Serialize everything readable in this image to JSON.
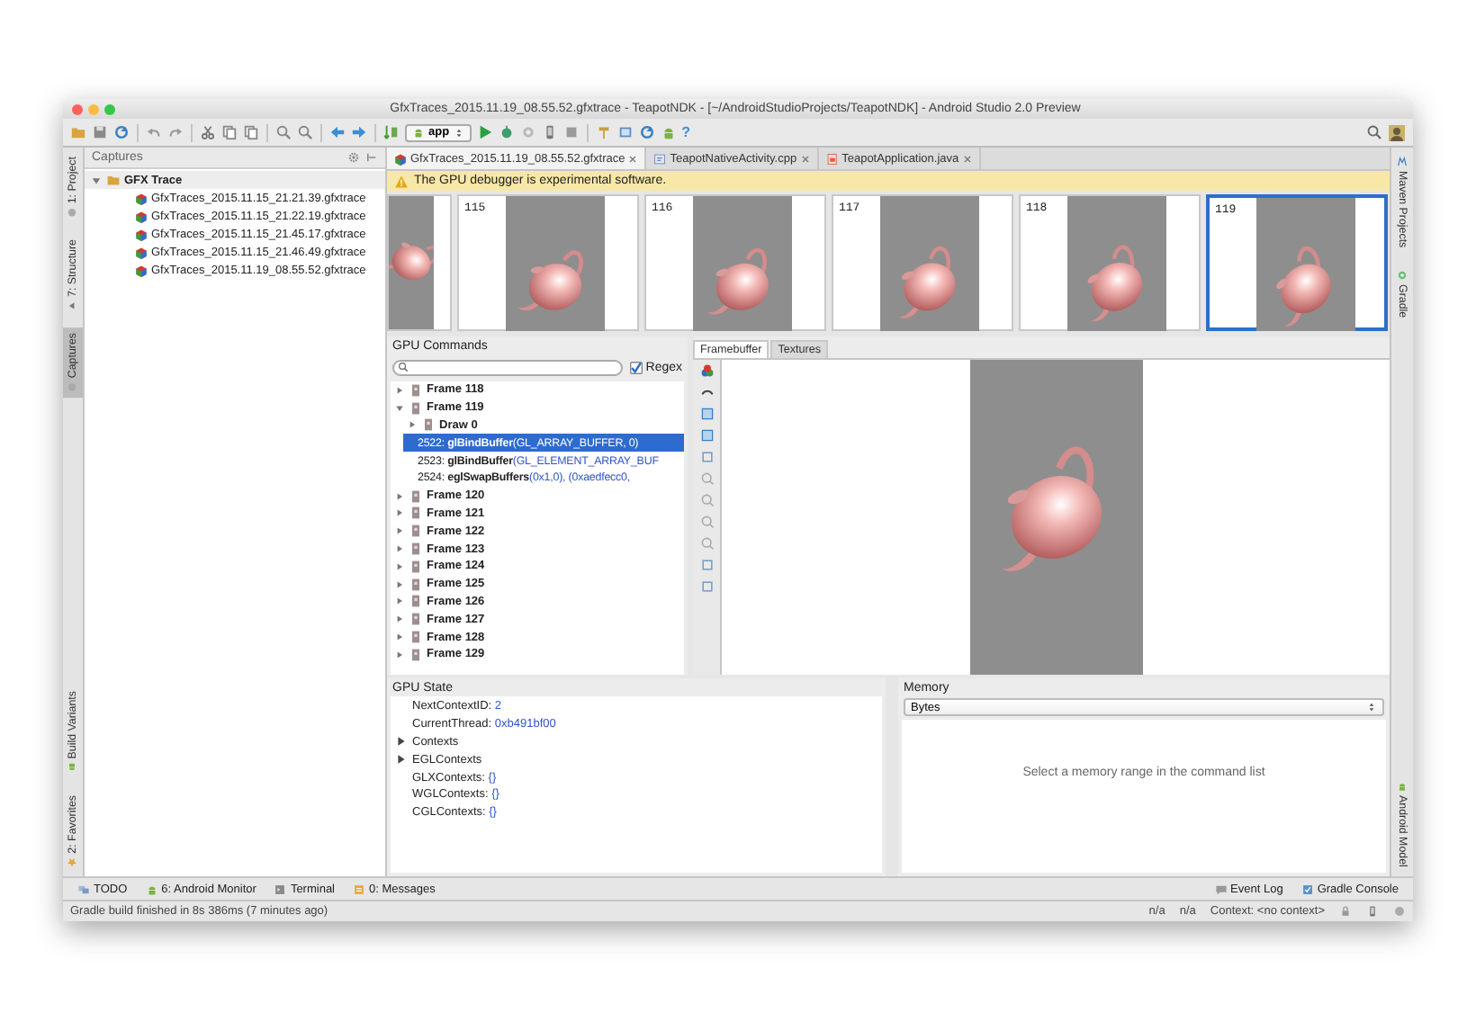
{
  "window": {
    "title": "GfxTraces_2015.11.19_08.55.52.gfxtrace - TeapotNDK - [~/AndroidStudioProjects/TeapotNDK] - Android Studio 2.0 Preview"
  },
  "toolbar": {
    "run_config": "app",
    "help": "?"
  },
  "left_tool_strip": {
    "top": [
      {
        "label": "1: Project",
        "selected": false
      },
      {
        "label": "7: Structure",
        "selected": false
      },
      {
        "label": "Captures",
        "selected": true
      }
    ],
    "bottom": [
      {
        "label": "Build Variants",
        "selected": false
      },
      {
        "label": "2: Favorites",
        "selected": false
      }
    ]
  },
  "captures": {
    "title": "Captures",
    "tree": [
      {
        "label": "GFX Trace",
        "expanded": true,
        "children": [
          {
            "label": "GfxTraces_2015.11.15_21.21.39.gfxtrace"
          },
          {
            "label": "GfxTraces_2015.11.15_21.22.19.gfxtrace"
          },
          {
            "label": "GfxTraces_2015.11.15_21.45.17.gfxtrace"
          },
          {
            "label": "GfxTraces_2015.11.15_21.46.49.gfxtrace"
          },
          {
            "label": "GfxTraces_2015.11.19_08.55.52.gfxtrace"
          }
        ]
      }
    ]
  },
  "editor_tabs": [
    {
      "label": "GfxTraces_2015.11.19_08.55.52.gfxtrace",
      "kind": "trace",
      "selected": true
    },
    {
      "label": "TeapotNativeActivity.cpp",
      "kind": "cpp",
      "selected": false
    },
    {
      "label": "TeapotApplication.java",
      "kind": "java",
      "selected": false
    }
  ],
  "banner": "The GPU debugger is experimental software.",
  "thumbnails": [
    {
      "label": "115",
      "selected": false
    },
    {
      "label": "116",
      "selected": false
    },
    {
      "label": "117",
      "selected": false
    },
    {
      "label": "118",
      "selected": false
    },
    {
      "label": "119",
      "selected": true
    }
  ],
  "gpu_commands": {
    "title": "GPU Commands",
    "regex": {
      "label": "Regex",
      "checked": true
    },
    "rows": [
      {
        "kind": "frame",
        "label": "Frame 118",
        "expanded": false,
        "selected": false
      },
      {
        "kind": "frame",
        "label": "Frame 119",
        "expanded": true,
        "selected": false,
        "children": [
          {
            "kind": "draw",
            "label": "Draw 0",
            "expanded": false,
            "selected": false
          },
          {
            "kind": "call",
            "index": "2522:",
            "name": "glBindBuffer",
            "args": "(GL_ARRAY_BUFFER, 0)",
            "selected": true
          },
          {
            "kind": "call",
            "index": "2523:",
            "name": "glBindBuffer",
            "args": "(GL_ELEMENT_ARRAY_BUF",
            "selected": false
          },
          {
            "kind": "call",
            "index": "2524:",
            "name": "eglSwapBuffers",
            "args": "(0x1,0), (0xaedfecc0,",
            "selected": false
          }
        ]
      },
      {
        "kind": "frame",
        "label": "Frame 120",
        "expanded": false,
        "selected": false
      },
      {
        "kind": "frame",
        "label": "Frame 121",
        "expanded": false,
        "selected": false
      },
      {
        "kind": "frame",
        "label": "Frame 122",
        "expanded": false,
        "selected": false
      },
      {
        "kind": "frame",
        "label": "Frame 123",
        "expanded": false,
        "selected": false
      },
      {
        "kind": "frame",
        "label": "Frame 124",
        "expanded": false,
        "selected": false
      },
      {
        "kind": "frame",
        "label": "Frame 125",
        "expanded": false,
        "selected": false
      },
      {
        "kind": "frame",
        "label": "Frame 126",
        "expanded": false,
        "selected": false
      },
      {
        "kind": "frame",
        "label": "Frame 127",
        "expanded": false,
        "selected": false
      },
      {
        "kind": "frame",
        "label": "Frame 128",
        "expanded": false,
        "selected": false
      },
      {
        "kind": "frame",
        "label": "Frame 129",
        "expanded": false,
        "selected": false
      }
    ]
  },
  "framebuffer": {
    "tabs": [
      {
        "label": "Framebuffer",
        "selected": true
      },
      {
        "label": "Textures",
        "selected": false
      }
    ]
  },
  "gpu_state": {
    "title": "GPU State",
    "items": [
      {
        "kind": "value",
        "key": "NextContextID:",
        "value": "2"
      },
      {
        "kind": "value",
        "key": "CurrentThread:",
        "value": "0xb491bf00"
      },
      {
        "kind": "group",
        "key": "Contexts",
        "expanded": false
      },
      {
        "kind": "group",
        "key": "EGLContexts",
        "expanded": false
      },
      {
        "kind": "value",
        "key": "GLXContexts:",
        "value": "{}"
      },
      {
        "kind": "value",
        "key": "WGLContexts:",
        "value": "{}"
      },
      {
        "kind": "value",
        "key": "CGLContexts:",
        "value": "{}"
      }
    ]
  },
  "memory": {
    "title": "Memory",
    "format": "Bytes",
    "message": "Select a memory range in the command list"
  },
  "right_tool_strip": {
    "top": [
      {
        "label": "Maven Projects"
      },
      {
        "label": "Gradle"
      }
    ],
    "bottom": [
      {
        "label": "Android Model"
      }
    ]
  },
  "bottom_tools": {
    "left": [
      {
        "label": "TODO"
      },
      {
        "label": "6: Android Monitor"
      },
      {
        "label": "Terminal"
      },
      {
        "label": "0: Messages"
      }
    ],
    "right": [
      {
        "label": "Event Log"
      },
      {
        "label": "Gradle Console"
      }
    ]
  },
  "status_bar": {
    "message": "Gradle build finished in 8s 386ms (7 minutes ago)",
    "items": [
      "n/a",
      "n/a",
      "Context: <no context>"
    ]
  }
}
